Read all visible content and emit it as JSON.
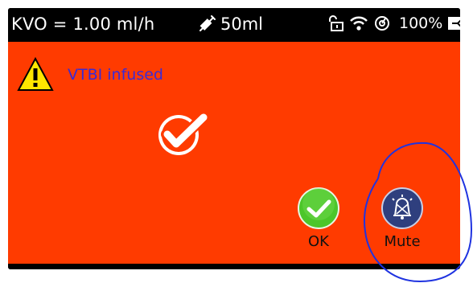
{
  "status_bar": {
    "kvo": "KVO = 1.00 ml/h",
    "volume": "50ml",
    "battery": "100%",
    "icons": [
      "syringe-icon",
      "unlock-icon",
      "wifi-icon",
      "pressure-gauge-icon",
      "battery-charging-icon"
    ]
  },
  "alarm": {
    "message": "VTBI infused",
    "icon": "warning-triangle-icon",
    "background_color": "#ff3b00",
    "message_color": "#3a2ad6"
  },
  "buttons": {
    "ok_label": "OK",
    "mute_label": "Mute"
  },
  "colors": {
    "ok_green": "#4cc62a",
    "mute_navy": "#2f3f7e",
    "annotation_blue": "#1f33e0"
  }
}
